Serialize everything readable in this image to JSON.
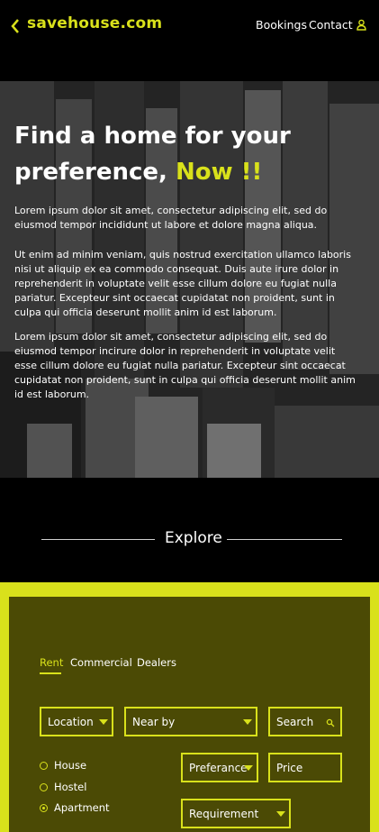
{
  "header": {
    "logo": "savehouse.com",
    "nav": [
      {
        "label": "Bookings"
      },
      {
        "label": "Contact"
      }
    ]
  },
  "hero": {
    "title_line1": "Find a home for your",
    "title_line2": "preference, ",
    "title_accent": "Now !!",
    "paragraphs": [
      "Lorem ipsum dolor sit amet, consectetur adipiscing elit, sed do eiusmod tempor incididunt ut labore et dolore magna aliqua.",
      "Ut enim ad minim veniam, quis nostrud exercitation ullamco laboris nisi ut aliquip ex ea commodo consequat. Duis aute irure dolor in reprehenderit in voluptate velit esse cillum dolore eu fugiat nulla pariatur. Excepteur sint occaecat cupidatat non proident, sunt in culpa qui officia deserunt mollit anim id est laborum.",
      "Lorem ipsum dolor sit amet, consectetur adipiscing elit, sed do eiusmod tempor incirure dolor in reprehenderit in voluptate velit esse cillum dolore eu fugiat nulla pariatur. Excepteur sint occaecat cupidatat non proident, sunt in culpa qui officia deserunt mollit anim id est laborum."
    ]
  },
  "explore": {
    "label": "Explore"
  },
  "search_panel": {
    "tabs": [
      {
        "label": "Rent",
        "active": true
      },
      {
        "label": "Commercial",
        "active": false
      },
      {
        "label": "Dealers",
        "active": false
      }
    ],
    "location": "Location",
    "near_by": "Near by",
    "search": "Search",
    "preference": "Preferance",
    "price": "Price",
    "requirement": "Requirement",
    "property_types": [
      {
        "label": "House",
        "selected": false
      },
      {
        "label": "Hostel",
        "selected": false
      },
      {
        "label": "Apartment",
        "selected": true
      }
    ]
  },
  "colors": {
    "accent": "#d9e11b",
    "panel": "#4b4a05",
    "background": "#000000"
  },
  "icons": [
    "chevron-left-icon",
    "user-icon",
    "search-icon"
  ]
}
